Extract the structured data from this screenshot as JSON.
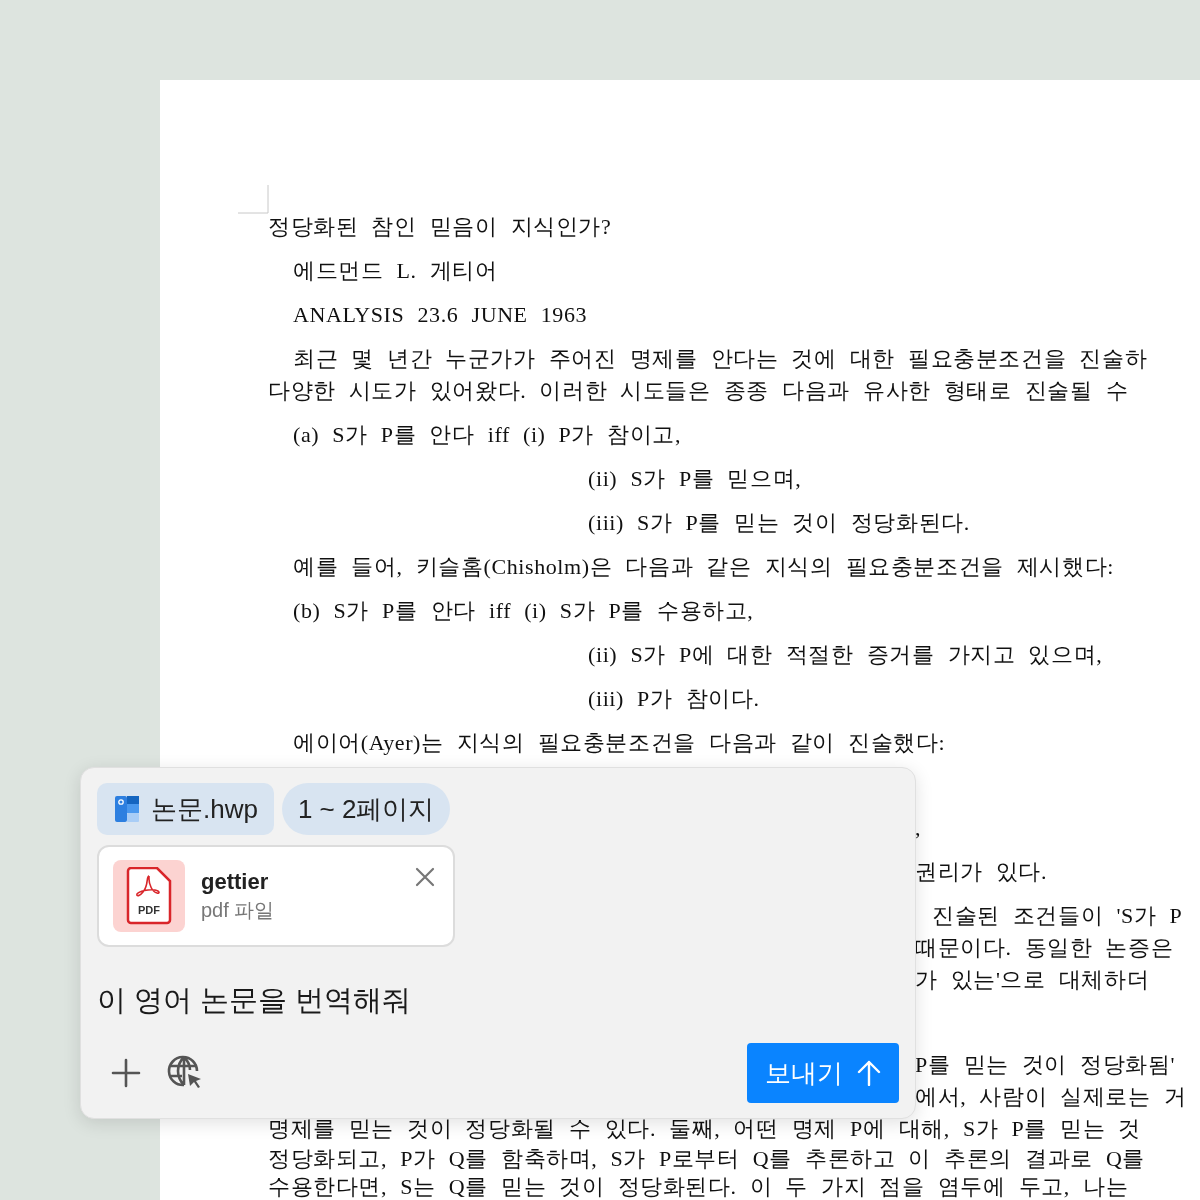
{
  "document": {
    "lines": [
      {
        "kind": "first",
        "text": "정당화된 참인 믿음이 지식인가?"
      },
      {
        "kind": "indent",
        "text": "에드먼드 L. 게티어"
      },
      {
        "kind": "indent",
        "text": "ANALYSIS 23.6 JUNE 1963"
      },
      {
        "kind": "indent",
        "text": "최근 몇 년간 누군가가 주어진 명제를 안다는 것에 대한 필요충분조건을 진술하"
      },
      {
        "kind": "cont",
        "text": "다양한 시도가 있어왔다. 이러한 시도들은 종종 다음과 유사한 형태로 진술될 수"
      },
      {
        "kind": "indent",
        "text": "(a) S가 P를 안다 iff (i) P가 참이고,"
      },
      {
        "kind": "sub",
        "text": "(ii) S가 P를 믿으며,"
      },
      {
        "kind": "sub",
        "text": "(iii) S가 P를 믿는 것이 정당화된다."
      },
      {
        "kind": "indent",
        "text": "예를 들어, 키슬홈(Chisholm)은 다음과 같은 지식의 필요충분조건을 제시했다:"
      },
      {
        "kind": "indent",
        "text": "(b) S가 P를 안다 iff (i) S가 P를 수용하고,"
      },
      {
        "kind": "sub",
        "text": "(ii) S가 P에 대한 적절한 증거를 가지고 있으며,"
      },
      {
        "kind": "sub",
        "text": "(iii) P가 참이다."
      },
      {
        "kind": "indent",
        "text": "에이어(Ayer)는 지식의 필요충분조건을 다음과 같이 진술했다:"
      },
      {
        "kind": "tail-break",
        "text": ","
      },
      {
        "kind": "tail",
        "text": "권리가 있다."
      },
      {
        "kind": "tail-in",
        "text": "진술된 조건들이 'S가 P"
      },
      {
        "kind": "tail-cont",
        "text": "때문이다. 동일한 논증은"
      },
      {
        "kind": "tail-cont",
        "text": "가 있는'으로 대체하더"
      },
      {
        "kind": "tail-break",
        "text": "P를 믿는 것이 정당화됨'"
      },
      {
        "kind": "tail-cont",
        "text": "에서, 사람이 실제로는 거"
      },
      {
        "kind": "cont",
        "text": "명제를 믿는 것이 정당화될 수 있다. 둘째, 어떤 명제 P에 대해, S가 P를 믿는 것"
      },
      {
        "kind": "cont",
        "text": "정당화되고, P가 Q를 함축하며, S가 P로부터 Q를 추론하고 이 추론의 결과로 Q를"
      },
      {
        "kind": "cont",
        "text": "수용한다면, S는 Q를 믿는 것이 정당화된다. 이 두 가지 점을 염두에 두고, 나는"
      }
    ]
  },
  "chat_panel": {
    "attachments": [
      {
        "kind": "file",
        "label": "논문.hwp"
      },
      {
        "kind": "range",
        "label": "1 ~ 2페이지"
      }
    ],
    "file_card": {
      "icon_label": "PDF",
      "name": "gettier",
      "type": "pdf 파일"
    },
    "prompt": "이 영어 논문을 번역해줘",
    "send_button": "보내기"
  }
}
